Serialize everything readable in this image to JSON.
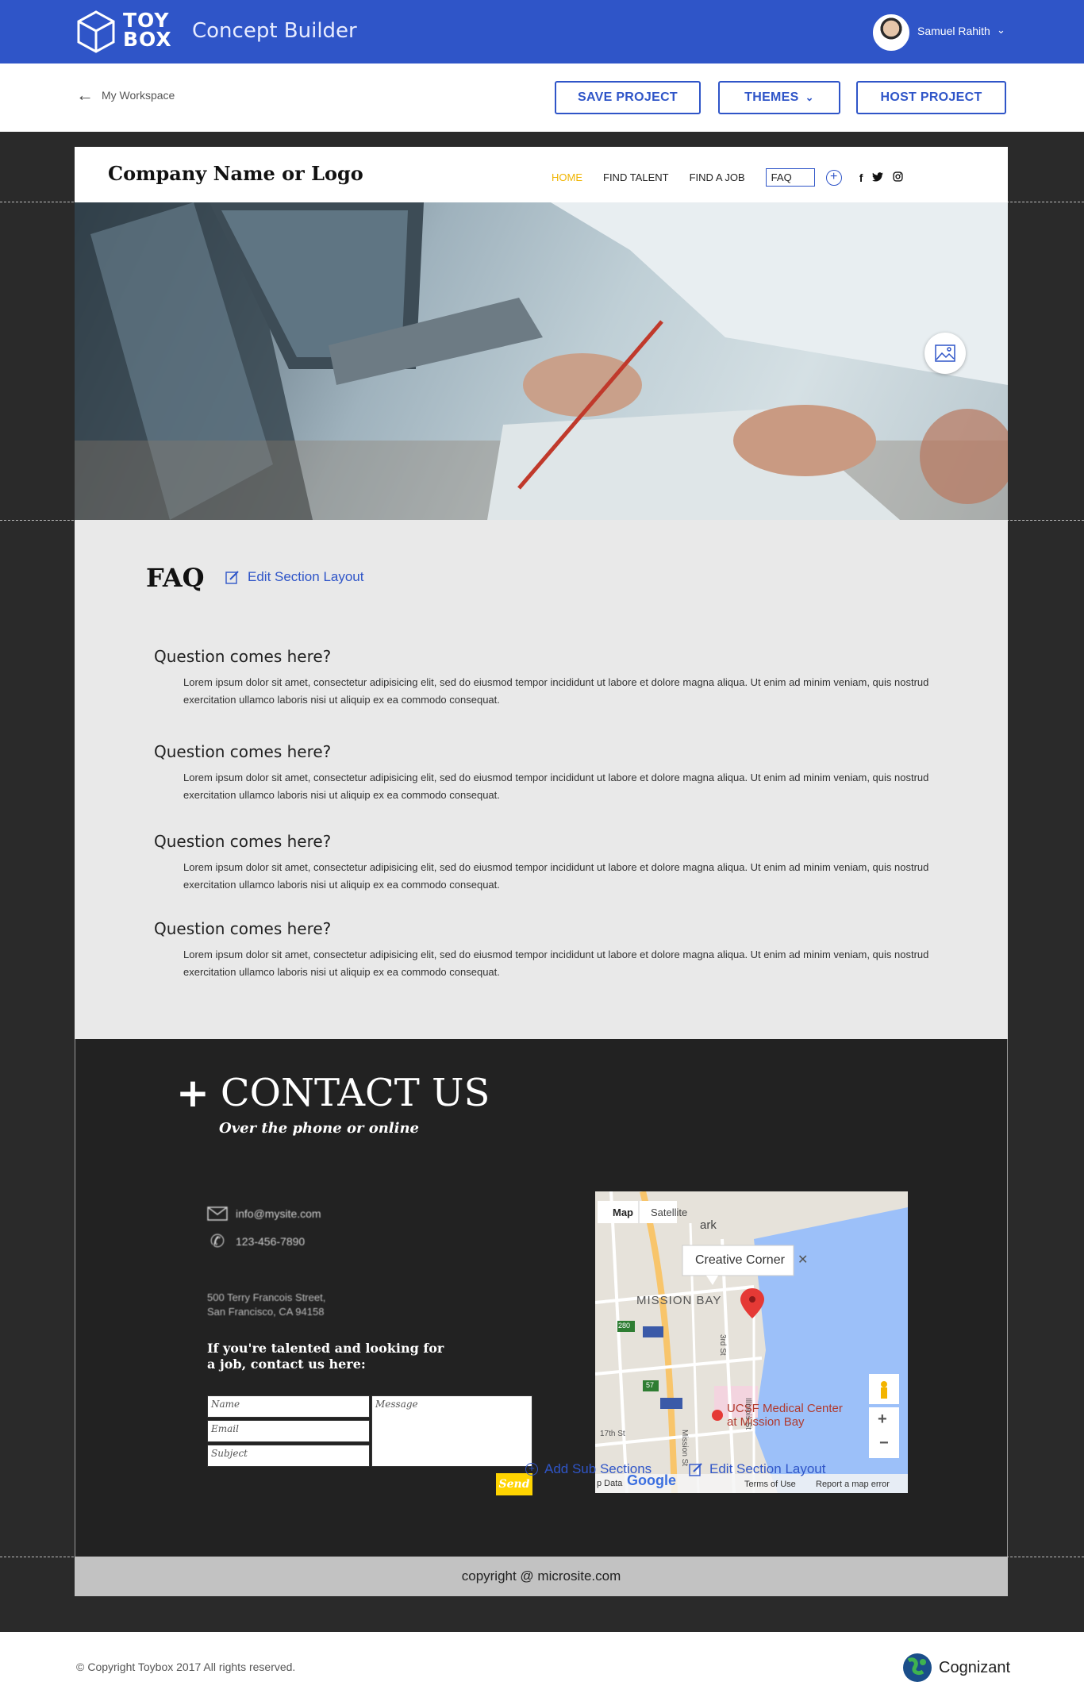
{
  "app": {
    "logo_line1": "TOY",
    "logo_line2": "BOX",
    "title": "Concept Builder",
    "user_name": "Samuel Rahith"
  },
  "toolbar": {
    "back_label": "My Workspace",
    "save_label": "SAVE PROJECT",
    "themes_label": "THEMES",
    "host_label": "HOST PROJECT"
  },
  "site": {
    "logo_text": "Company Name or Logo",
    "nav": {
      "home": "HOME",
      "find_talent": "FIND TALENT",
      "find_job": "FIND A JOB",
      "faq": "FAQ"
    },
    "faq_section": {
      "title": "FAQ",
      "edit_layout_label": "Edit Section Layout",
      "items": [
        {
          "question": "Question comes here?",
          "answer": "Lorem ipsum dolor sit amet, consectetur adipisicing elit, sed do eiusmod tempor incididunt ut labore et dolore magna aliqua. Ut enim ad minim veniam, quis nostrud exercitation ullamco laboris nisi ut aliquip ex ea commodo consequat."
        },
        {
          "question": "Question comes here?",
          "answer": "Lorem ipsum dolor sit amet, consectetur adipisicing elit, sed do eiusmod tempor incididunt ut labore et dolore magna aliqua. Ut enim ad minim veniam, quis nostrud exercitation ullamco laboris nisi ut aliquip ex ea commodo consequat."
        },
        {
          "question": "Question comes here?",
          "answer": "Lorem ipsum dolor sit amet, consectetur adipisicing elit, sed do eiusmod tempor incididunt ut labore et dolore magna aliqua. Ut enim ad minim veniam, quis nostrud exercitation ullamco laboris nisi ut aliquip ex ea commodo consequat."
        },
        {
          "question": "Question comes here?",
          "answer": "Lorem ipsum dolor sit amet, consectetur adipisicing elit, sed do eiusmod tempor incididunt ut labore et dolore magna aliqua. Ut enim ad minim veniam, quis nostrud exercitation ullamco laboris nisi ut aliquip ex ea commodo consequat."
        }
      ]
    },
    "contact": {
      "title": "CONTACT US",
      "subtitle": "Over the phone or online",
      "email": "info@mysite.com",
      "phone": "123-456-7890",
      "address_line1": "500 Terry Francois Street,",
      "address_line2": "San Francisco, CA 94158",
      "cta_heading": "If you're talented and looking for a job, contact us here:",
      "name_placeholder": "Name",
      "email_placeholder": "Email",
      "subject_placeholder": "Subject",
      "message_placeholder": "Message",
      "send_label": "Send",
      "add_sub_sections_label": "Add Sub Sections",
      "edit_layout_label": "Edit Section Layout",
      "map": {
        "tab_map": "Map",
        "tab_satellite": "Satellite",
        "popup": "Creative Corner",
        "label_mission_bay": "MISSION BAY",
        "label_ucsf": "UCSF Medical Center",
        "label_ucsf2": "at Mission Bay",
        "label_park": "ark",
        "road_280": "280",
        "road_57": "57",
        "road_3rd": "3rd St",
        "road_17th": "17th St",
        "road_mission": "Mission St",
        "road_illinois": "Illinois St",
        "google": "Google",
        "terms": "Terms of Use",
        "report": "Report a map error",
        "map_data": "p Data"
      }
    },
    "footer_text": "copyright @ microsite.com"
  },
  "page_footer": {
    "copyright": "Copyright Toybox 2017 All rights reserved.",
    "brand": "Cognizant"
  },
  "colors": {
    "brand_blue": "#2f55c8",
    "accent_yellow": "#f0b400",
    "dark_bg": "#2a2a2a"
  }
}
